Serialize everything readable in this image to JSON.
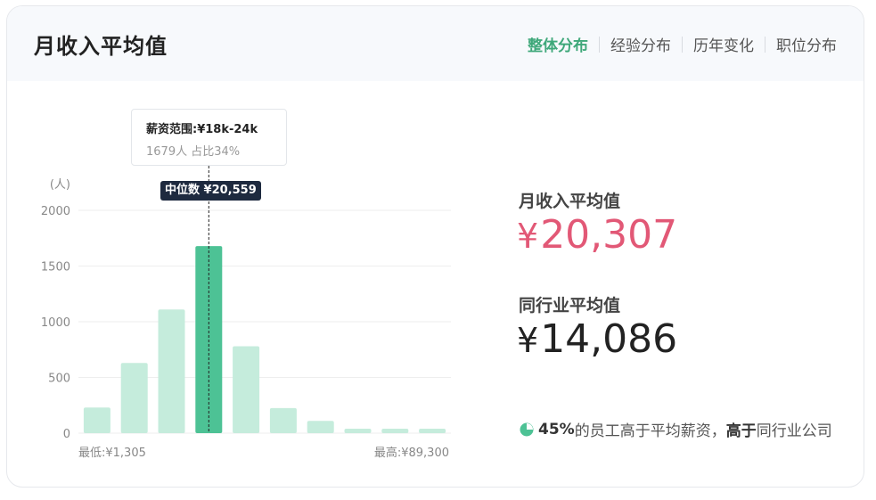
{
  "header": {
    "title": "月收入平均值",
    "tabs": [
      {
        "label": "整体分布",
        "active": true
      },
      {
        "label": "经验分布",
        "active": false
      },
      {
        "label": "历年变化",
        "active": false
      },
      {
        "label": "职位分布",
        "active": false
      }
    ]
  },
  "chart_data": {
    "type": "bar",
    "unit_label": "(人)",
    "yticks": [
      0,
      500,
      1000,
      1500,
      2000
    ],
    "ylim": [
      0,
      2000
    ],
    "values": [
      230,
      630,
      1110,
      1679,
      780,
      225,
      110,
      40,
      40,
      40
    ],
    "highlight_index": 3,
    "min_label": "最低:¥1,305",
    "max_label": "最高:¥89,300",
    "colors": {
      "bar": "#c5ecdc",
      "highlight": "#4dc295",
      "grid": "#eeeeee"
    }
  },
  "tooltip": {
    "range": "薪资范围:¥18k-24k",
    "detail": "1679人  占比34%"
  },
  "median": {
    "label": "中位数 ¥20,559"
  },
  "stats": {
    "avg_label": "月收入平均值",
    "avg_currency": "¥",
    "avg_value": "20,307",
    "industry_label": "同行业平均值",
    "industry_currency": "¥",
    "industry_value": "14,086"
  },
  "compare": {
    "pct": "45%",
    "text1": "的员工高于平均薪资，",
    "bold": "高于",
    "text2": "同行业公司",
    "icon": "pie-chart-icon"
  },
  "colors": {
    "accent": "#3fa87a",
    "pink": "#e25876",
    "dark": "#1e2a3f"
  }
}
